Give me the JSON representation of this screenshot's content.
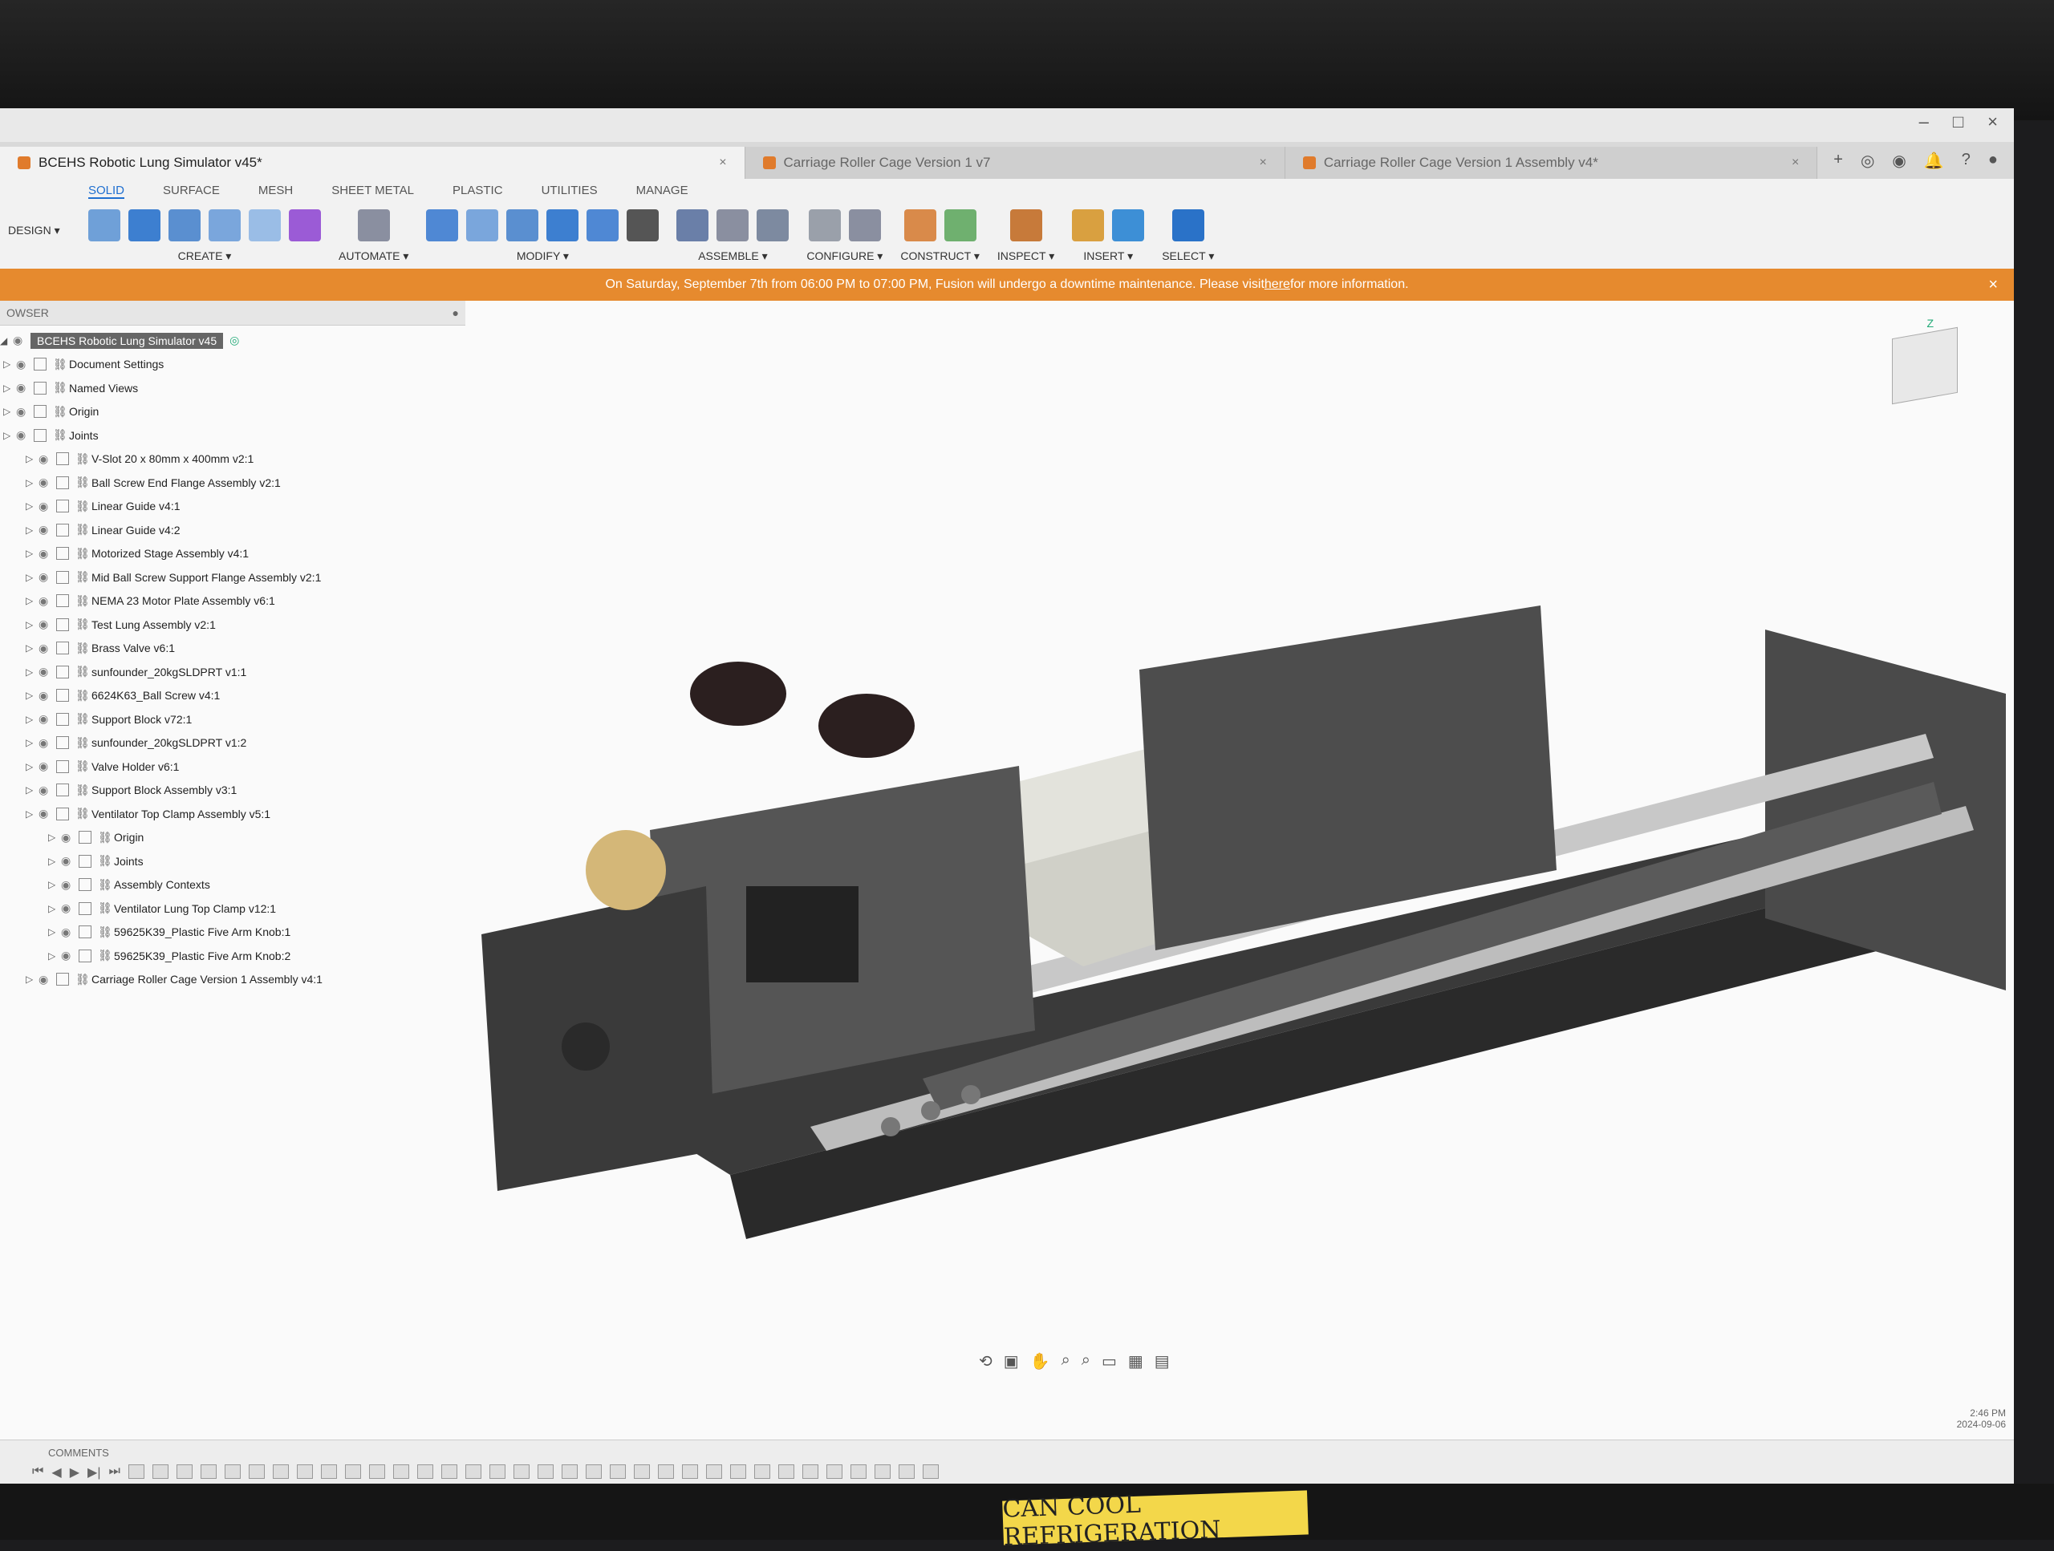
{
  "window": {
    "controls": [
      "–",
      "□",
      "×"
    ]
  },
  "tabs": [
    {
      "label": "BCEHS Robotic Lung Simulator v45*",
      "active": true
    },
    {
      "label": "Carriage Roller Cage Version 1 v7",
      "active": false
    },
    {
      "label": "Carriage Roller Cage Version 1 Assembly v4*",
      "active": false
    }
  ],
  "ribbon": {
    "workspace": "DESIGN ▾",
    "tabs": [
      "SOLID",
      "SURFACE",
      "MESH",
      "SHEET METAL",
      "PLASTIC",
      "UTILITIES",
      "MANAGE"
    ],
    "active_tab": "SOLID",
    "groups": [
      {
        "label": "CREATE ▾",
        "icons": 6
      },
      {
        "label": "AUTOMATE ▾",
        "icons": 1
      },
      {
        "label": "MODIFY ▾",
        "icons": 6
      },
      {
        "label": "ASSEMBLE ▾",
        "icons": 3
      },
      {
        "label": "CONFIGURE ▾",
        "icons": 2
      },
      {
        "label": "CONSTRUCT ▾",
        "icons": 2
      },
      {
        "label": "INSPECT ▾",
        "icons": 1
      },
      {
        "label": "INSERT ▾",
        "icons": 2
      },
      {
        "label": "SELECT ▾",
        "icons": 1
      }
    ]
  },
  "banner": {
    "text_before": "On Saturday, September 7th from 06:00 PM to 07:00 PM, Fusion will undergo a downtime maintenance. Please visit ",
    "link": "here",
    "text_after": " for more information.",
    "close": "×"
  },
  "browser": {
    "title": "OWSER",
    "root": "BCEHS Robotic Lung Simulator v45",
    "items": [
      "Document Settings",
      "Named Views",
      "Origin",
      "Joints",
      "V-Slot 20 x 80mm x 400mm v2:1",
      "Ball Screw End Flange Assembly v2:1",
      "Linear Guide v4:1",
      "Linear Guide v4:2",
      "Motorized Stage Assembly v4:1",
      "Mid Ball Screw Support Flange Assembly v2:1",
      "NEMA 23 Motor Plate Assembly v6:1",
      "Test Lung Assembly v2:1",
      "Brass Valve v6:1",
      "sunfounder_20kgSLDPRT v1:1",
      "6624K63_Ball Screw v4:1",
      "Support Block v72:1",
      "sunfounder_20kgSLDPRT v1:2",
      "Valve Holder v6:1",
      "Support Block Assembly v3:1",
      "Ventilator Top Clamp Assembly v5:1",
      "Origin",
      "Joints",
      "Assembly Contexts",
      "Ventilator Lung Top Clamp v12:1",
      "59625K39_Plastic Five Arm Knob:1",
      "59625K39_Plastic Five Arm Knob:2",
      "Carriage Roller Cage Version 1 Assembly v4:1"
    ]
  },
  "viewcube": {
    "axis": "Z"
  },
  "status": {
    "time": "2:46 PM",
    "date": "2024-09-06"
  },
  "comments": {
    "label": "COMMENTS"
  },
  "sticky_note": "CAN COOL REFRIGERATION"
}
